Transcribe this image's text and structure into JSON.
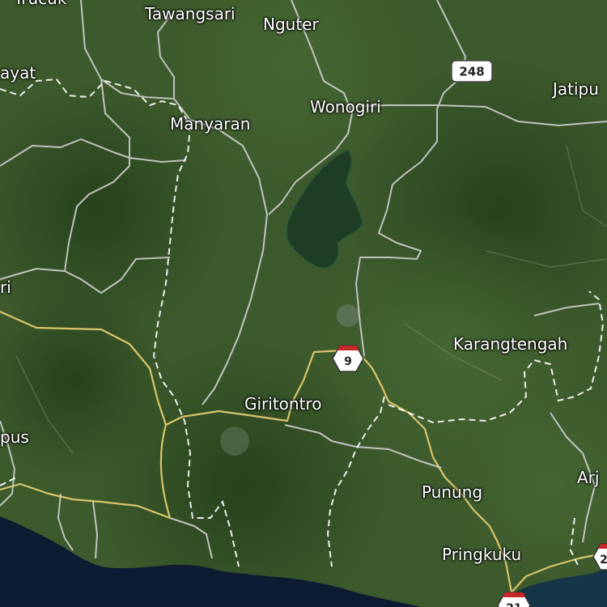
{
  "map": {
    "style": "satellite",
    "colors": {
      "land": "#3d5a2c",
      "forest": "#2c4a1f",
      "reservoir": "#1e3d24",
      "sea": "#0d1b33",
      "major_road": "#d8c56b",
      "minor_road": "#cfcfcf",
      "boundary": "#ffffff"
    },
    "places": [
      {
        "id": "place-tawangsari",
        "name": "Tawangsari"
      },
      {
        "id": "place-nguter",
        "name": "Nguter"
      },
      {
        "id": "place-wonogiri",
        "name": "Wonogiri"
      },
      {
        "id": "place-jatipu",
        "name": "Jatipu"
      },
      {
        "id": "place-ayat",
        "name": "ayat"
      },
      {
        "id": "place-manyaran",
        "name": "Manyaran"
      },
      {
        "id": "place-ri",
        "name": "ri"
      },
      {
        "id": "place-karangtengah",
        "name": "Karangtengah"
      },
      {
        "id": "place-giritontro",
        "name": "Giritontro"
      },
      {
        "id": "place-pus",
        "name": "pus"
      },
      {
        "id": "place-punung",
        "name": "Punung"
      },
      {
        "id": "place-arj",
        "name": "Arj"
      },
      {
        "id": "place-pringkuku",
        "name": "Pringkuku"
      },
      {
        "id": "place-trucuk",
        "name": "Trucuk"
      }
    ],
    "route_shields": [
      {
        "id": "shield-248",
        "number": "248",
        "style": "rect"
      },
      {
        "id": "shield-9",
        "number": "9",
        "style": "hex"
      },
      {
        "id": "shield-21",
        "number": "21",
        "style": "hex"
      },
      {
        "id": "shield-2",
        "number": "2",
        "style": "hex"
      }
    ]
  }
}
